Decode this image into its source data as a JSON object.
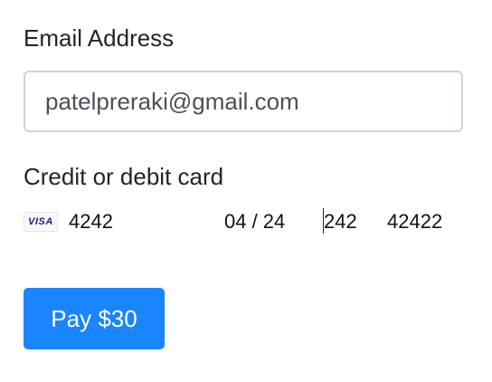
{
  "form": {
    "email": {
      "label": "Email Address",
      "value": "patelpreraki@gmail.com"
    },
    "card": {
      "label": "Credit or debit card",
      "brand_icon": "visa-card-icon",
      "brand_text": "VISA",
      "number": "4242",
      "expiry": "04 / 24",
      "cvc": "242",
      "postal": "42422"
    },
    "submit": {
      "label": "Pay $30"
    }
  },
  "colors": {
    "accent": "#1b84ff",
    "input_border": "#ced4da",
    "text": "#212529",
    "visa_blue": "#1a1f71"
  }
}
